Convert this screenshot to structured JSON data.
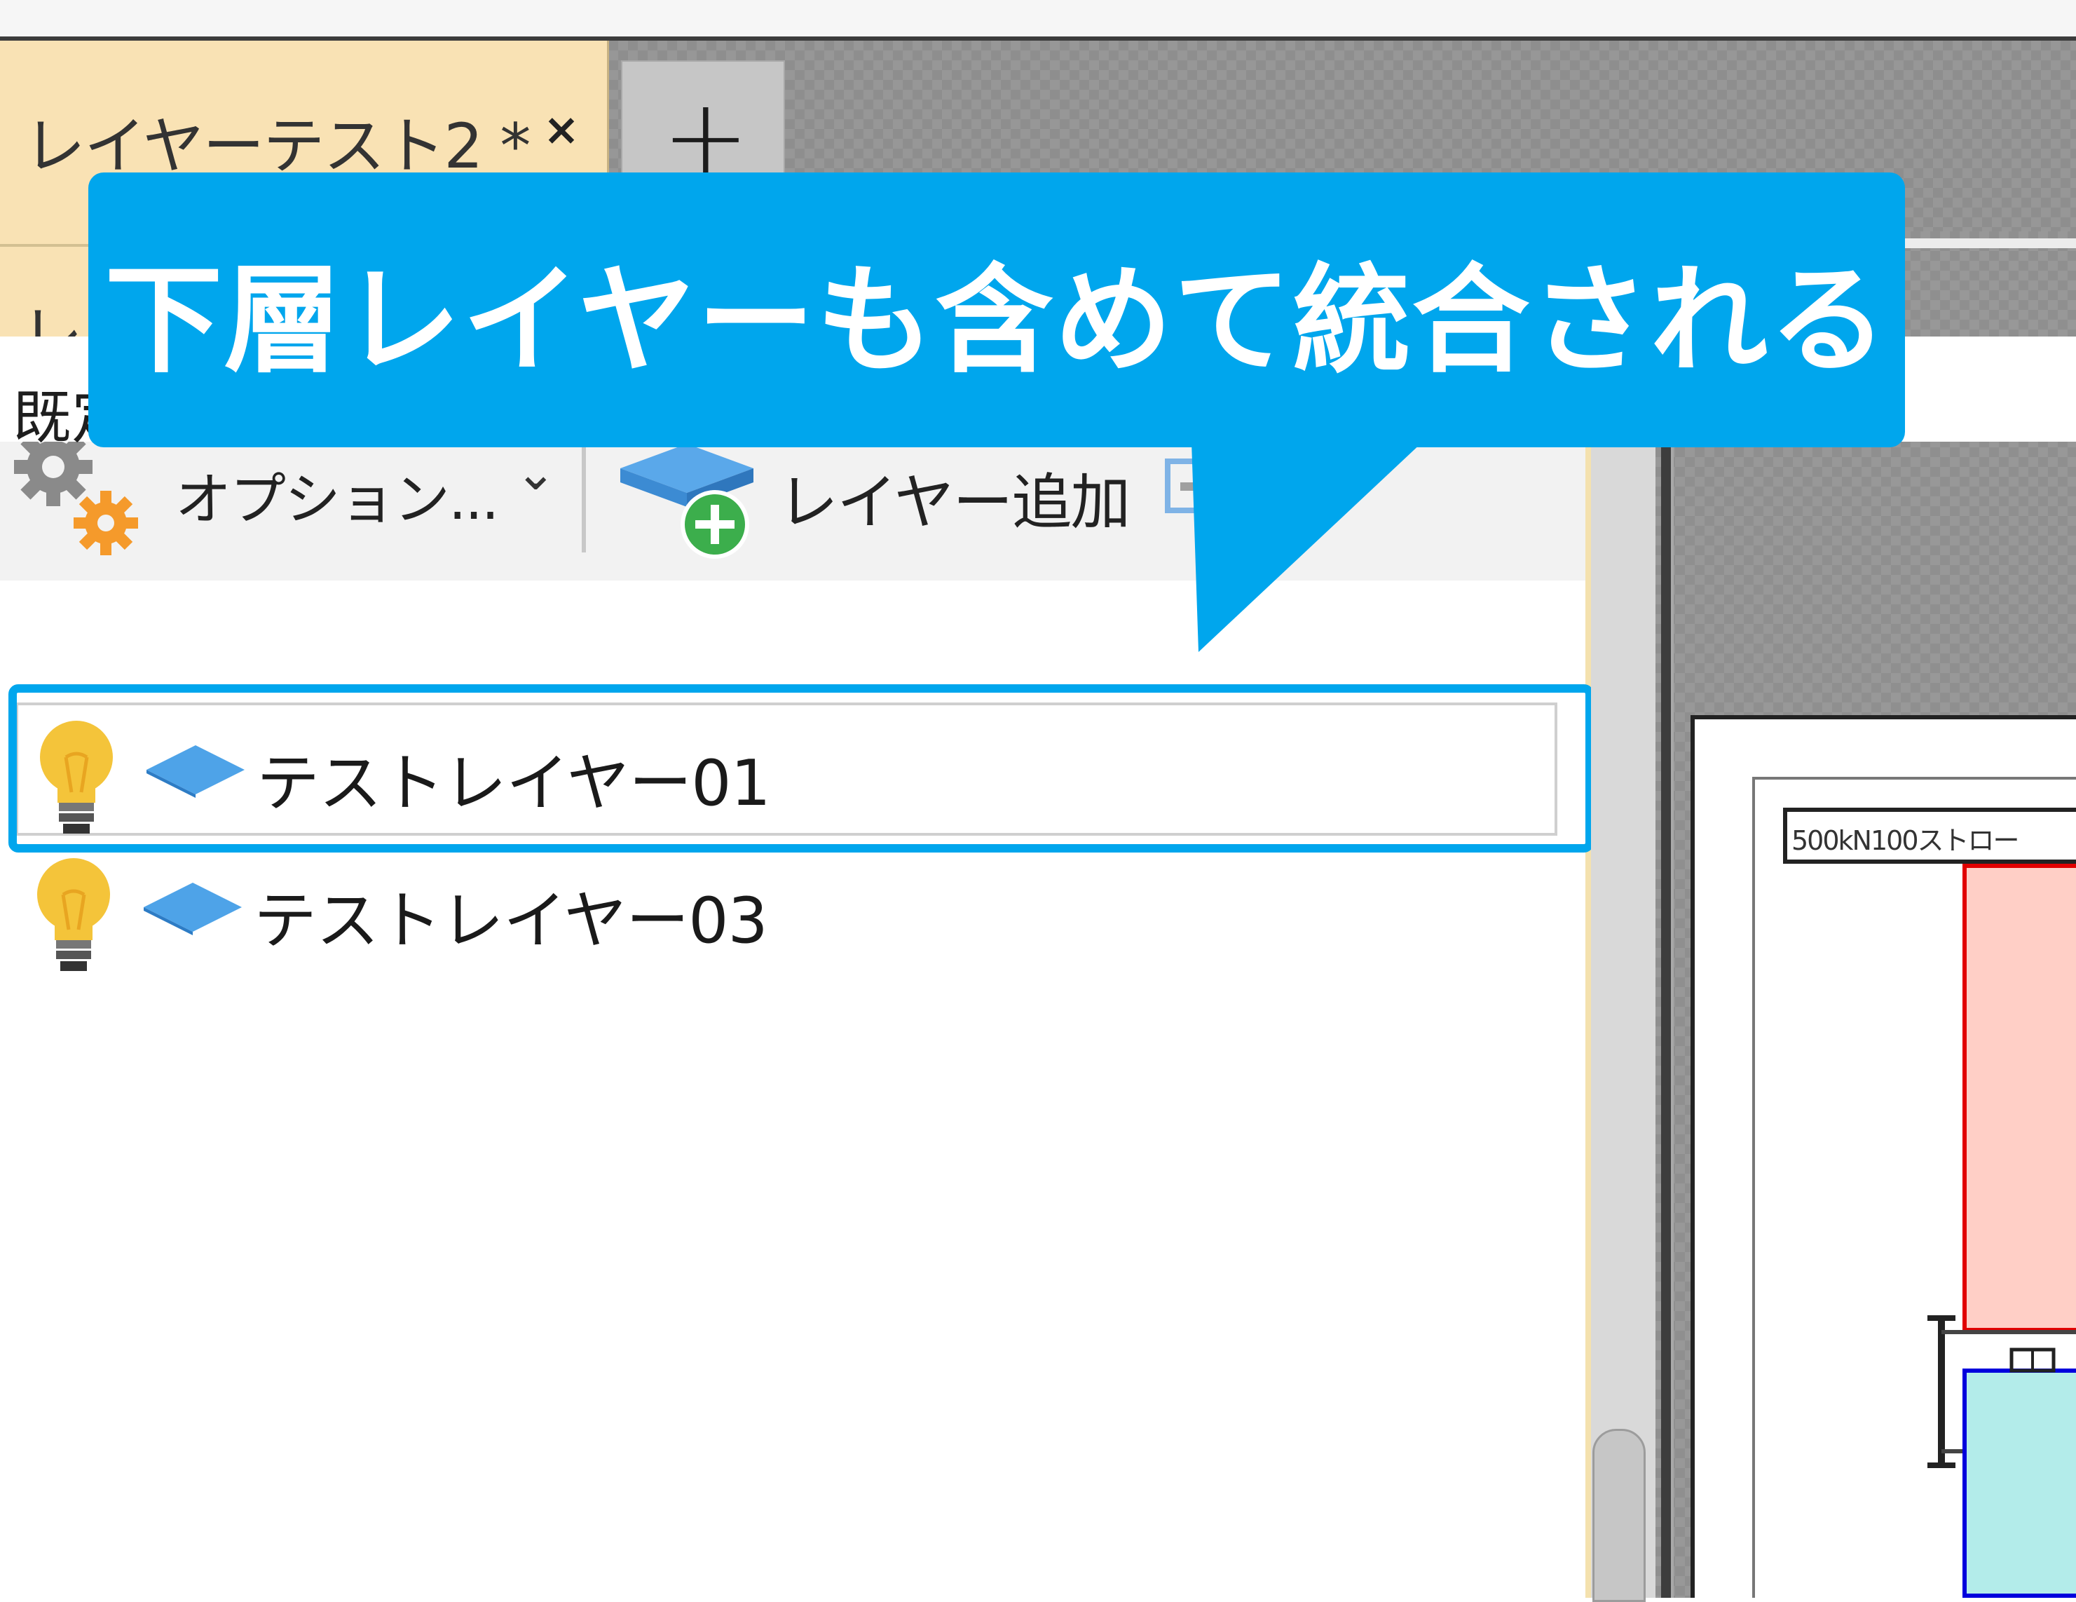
{
  "document_tab": {
    "label": "レイヤーテスト2 *",
    "close": "×"
  },
  "new_tab": {
    "label": "+"
  },
  "panel": {
    "header_label": "レ"
  },
  "toolbar": {
    "options_label": "オプション...",
    "options_chevron": "⌄",
    "add_layer_label": "レイヤー追加",
    "collapse": "⌃"
  },
  "default_row": {
    "text": "既定: なし",
    "chevron": "⌄"
  },
  "layers": [
    {
      "name": "テストレイヤー01",
      "selected": true
    },
    {
      "name": "テストレイヤー03",
      "selected": false
    }
  ],
  "drawing": {
    "title": "500kN100ストロー"
  },
  "callout": {
    "text": "下層レイヤーも含めて統合される"
  },
  "colors": {
    "accent": "#00a6ed",
    "tab": "#f9e2b4"
  }
}
